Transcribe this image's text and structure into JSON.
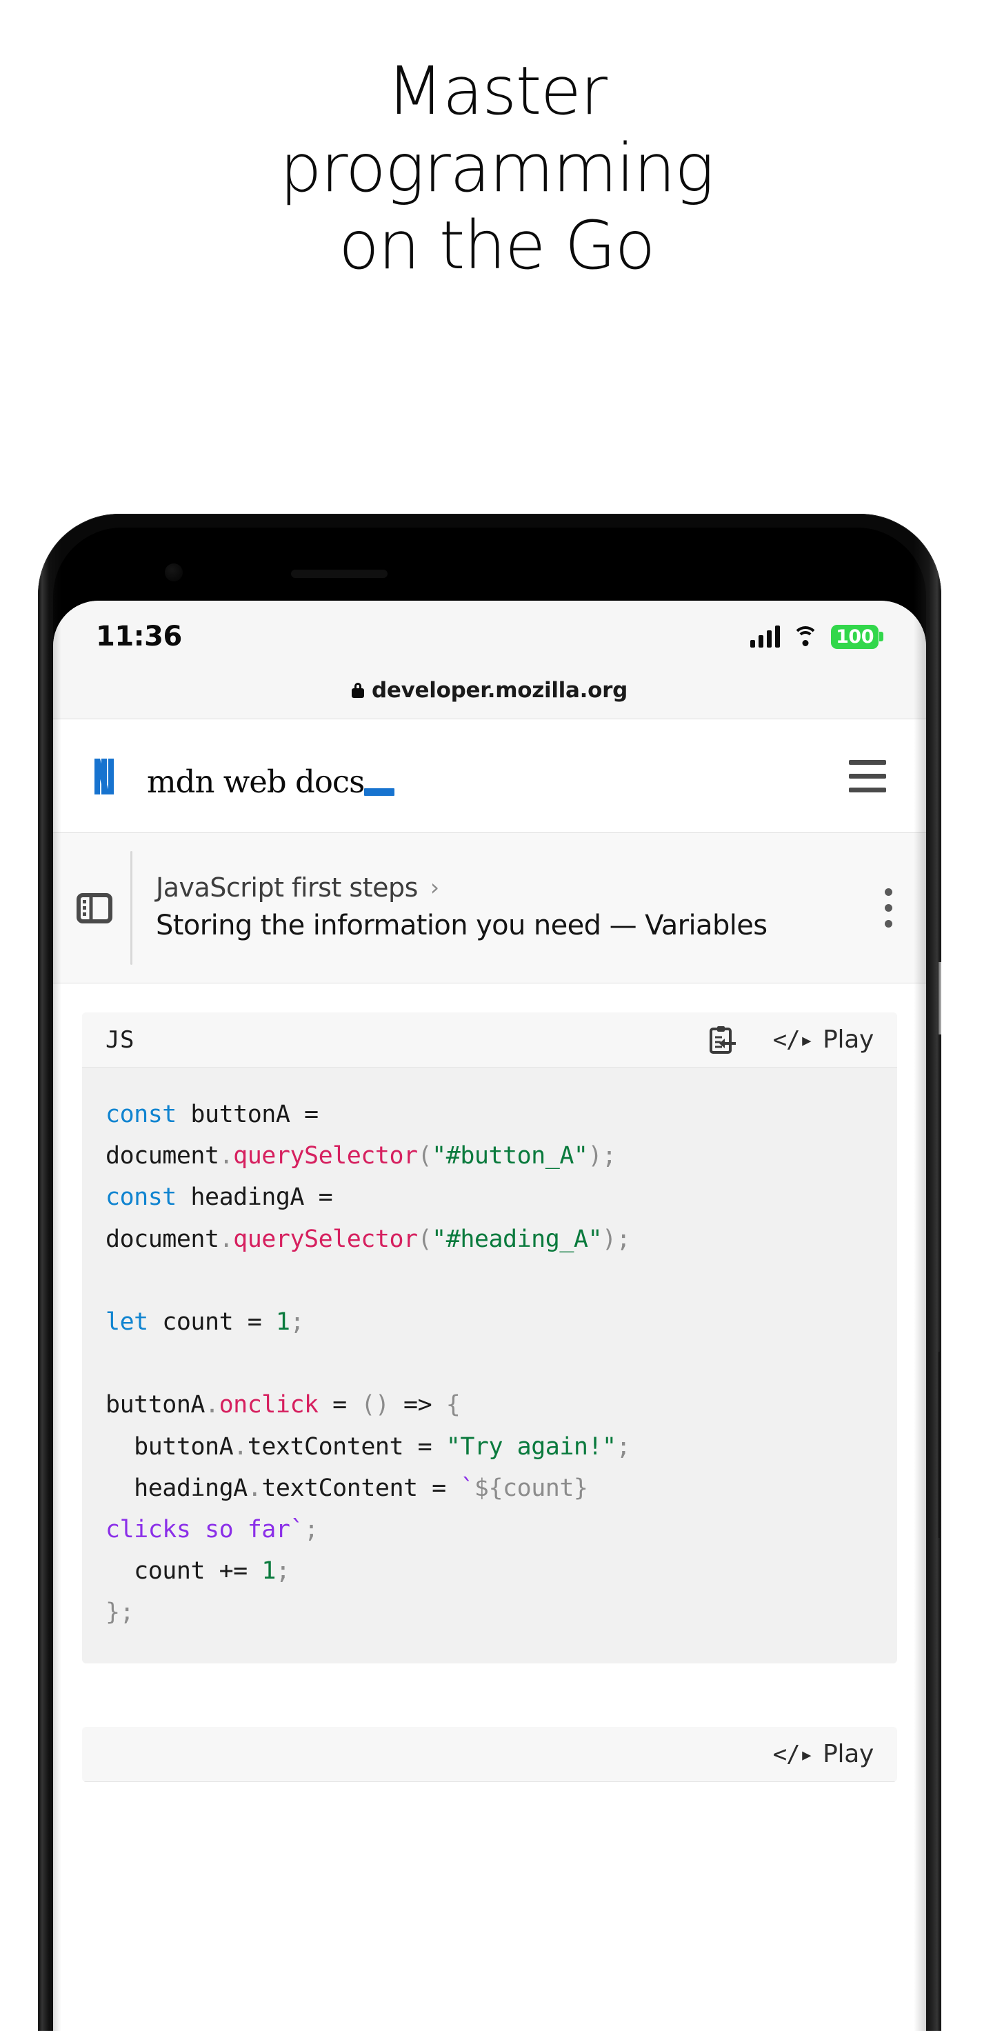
{
  "headline": {
    "lines": [
      "Master",
      "programming",
      "on the Go"
    ]
  },
  "phone": {
    "status_bar": {
      "time": "11:36",
      "battery_percent": "100",
      "battery_color": "#32d74b",
      "signal_icon": "signal-bars-icon",
      "wifi_icon": "wifi-icon"
    },
    "url_bar": {
      "lock_icon": "lock-icon",
      "url": "developer.mozilla.org"
    },
    "site_header": {
      "logo_mark": "mdn-logo-icon",
      "logo_text": "mdn web docs",
      "menu_icon": "hamburger-menu-icon"
    },
    "breadcrumb": {
      "sidebar_toggle_icon": "sidebar-toggle-icon",
      "parent": "JavaScript first steps",
      "chevron": "›",
      "current": "Storing the information you need — Variables",
      "kebab_icon": "kebab-menu-icon"
    },
    "code_block": {
      "language": "JS",
      "copy_icon": "copy-to-clipboard-icon",
      "play_glyph": "</▸",
      "play_label": "Play",
      "accent_blue": "#1084d0",
      "accent_crimson": "#d6205f",
      "accent_green": "#0a7a3d",
      "accent_purple": "#8b2fe8",
      "lines": [
        [
          {
            "t": "const",
            "c": "tok-kw"
          },
          {
            "t": " buttonA =\ndocument",
            "c": ""
          },
          {
            "t": ".",
            "c": "tok-pun"
          },
          {
            "t": "querySelector",
            "c": "tok-fn"
          },
          {
            "t": "(",
            "c": "tok-pun"
          },
          {
            "t": "\"#button_A\"",
            "c": "tok-str"
          },
          {
            "t": ")",
            "c": "tok-pun"
          },
          {
            "t": ";",
            "c": "tok-pun"
          }
        ],
        [
          {
            "t": "const",
            "c": "tok-kw"
          },
          {
            "t": " headingA =\ndocument",
            "c": ""
          },
          {
            "t": ".",
            "c": "tok-pun"
          },
          {
            "t": "querySelector",
            "c": "tok-fn"
          },
          {
            "t": "(",
            "c": "tok-pun"
          },
          {
            "t": "\"#heading_A\"",
            "c": "tok-str"
          },
          {
            "t": ")",
            "c": "tok-pun"
          },
          {
            "t": ";",
            "c": "tok-pun"
          }
        ],
        [],
        [
          {
            "t": "let",
            "c": "tok-kw"
          },
          {
            "t": " count = ",
            "c": ""
          },
          {
            "t": "1",
            "c": "tok-num"
          },
          {
            "t": ";",
            "c": "tok-pun"
          }
        ],
        [],
        [
          {
            "t": "buttonA",
            "c": ""
          },
          {
            "t": ".",
            "c": "tok-pun"
          },
          {
            "t": "onclick",
            "c": "tok-fn"
          },
          {
            "t": " = ",
            "c": ""
          },
          {
            "t": "()",
            "c": "tok-pun"
          },
          {
            "t": " => ",
            "c": ""
          },
          {
            "t": "{",
            "c": "tok-pun"
          }
        ],
        [
          {
            "t": "  buttonA",
            "c": ""
          },
          {
            "t": ".",
            "c": "tok-pun"
          },
          {
            "t": "textContent = ",
            "c": ""
          },
          {
            "t": "\"Try again!\"",
            "c": "tok-str"
          },
          {
            "t": ";",
            "c": "tok-pun"
          }
        ],
        [
          {
            "t": "  headingA",
            "c": ""
          },
          {
            "t": ".",
            "c": "tok-pun"
          },
          {
            "t": "textContent = ",
            "c": ""
          },
          {
            "t": "`",
            "c": "tok-tpl"
          },
          {
            "t": "${count}",
            "c": "tok-gray"
          },
          {
            "t": "\nclicks so far`",
            "c": "tok-tpl"
          },
          {
            "t": ";",
            "c": "tok-pun"
          }
        ],
        [
          {
            "t": "  count += ",
            "c": ""
          },
          {
            "t": "1",
            "c": "tok-num"
          },
          {
            "t": ";",
            "c": "tok-pun"
          }
        ],
        [
          {
            "t": "}",
            "c": "tok-gray"
          },
          {
            "t": ";",
            "c": "tok-pun"
          }
        ]
      ]
    },
    "code_block_2": {
      "play_glyph": "</▸",
      "play_label": "Play"
    },
    "side_buttons": {
      "volume": "volume-button",
      "power": "power-button"
    }
  }
}
